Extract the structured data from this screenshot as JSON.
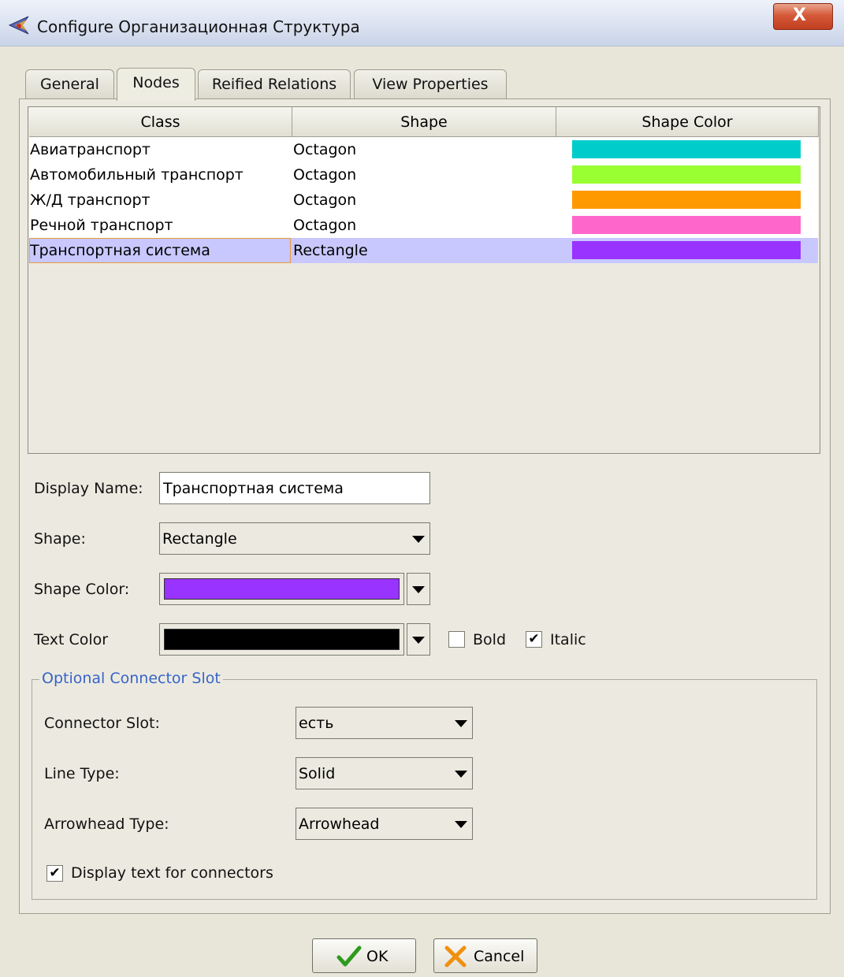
{
  "window": {
    "title": "Configure Организационная Структура",
    "close_glyph": "X"
  },
  "tabs": [
    {
      "label": "General",
      "active": false
    },
    {
      "label": "Nodes",
      "active": true
    },
    {
      "label": "Reified Relations",
      "active": false
    },
    {
      "label": "View Properties",
      "active": false
    }
  ],
  "table": {
    "columns": [
      "Class",
      "Shape",
      "Shape Color"
    ],
    "rows": [
      {
        "class": "Авиатранспорт",
        "shape": "Octagon",
        "color": "#00cccc"
      },
      {
        "class": "Автомобильный транспорт",
        "shape": "Octagon",
        "color": "#99ff33"
      },
      {
        "class": "Ж/Д транспорт",
        "shape": "Octagon",
        "color": "#ff9900"
      },
      {
        "class": "Речной транспорт",
        "shape": "Octagon",
        "color": "#ff66cc"
      },
      {
        "class": "Транспортная система",
        "shape": "Rectangle",
        "color": "#9933ff",
        "selected": true
      }
    ]
  },
  "form": {
    "display_name_label": "Display Name:",
    "display_name_value": "Транспортная система",
    "shape_label": "Shape:",
    "shape_value": "Rectangle",
    "shape_color_label": "Shape Color:",
    "shape_color_value": "#9933ff",
    "text_color_label": "Text Color",
    "text_color_value": "#000000",
    "bold_label": "Bold",
    "bold_checked": false,
    "italic_label": "Italic",
    "italic_checked": true
  },
  "connector": {
    "group_title": "Optional Connector Slot",
    "slot_label": "Connector Slot:",
    "slot_value": "есть",
    "line_type_label": "Line Type:",
    "line_type_value": "Solid",
    "arrowhead_label": "Arrowhead Type:",
    "arrowhead_value": "Arrowhead",
    "display_text_label": "Display text for connectors",
    "display_text_checked": true
  },
  "buttons": {
    "ok_label": "OK",
    "cancel_label": "Cancel"
  },
  "icons": {
    "app": "protege-icon",
    "ok": "checkmark-icon",
    "cancel": "x-icon"
  }
}
